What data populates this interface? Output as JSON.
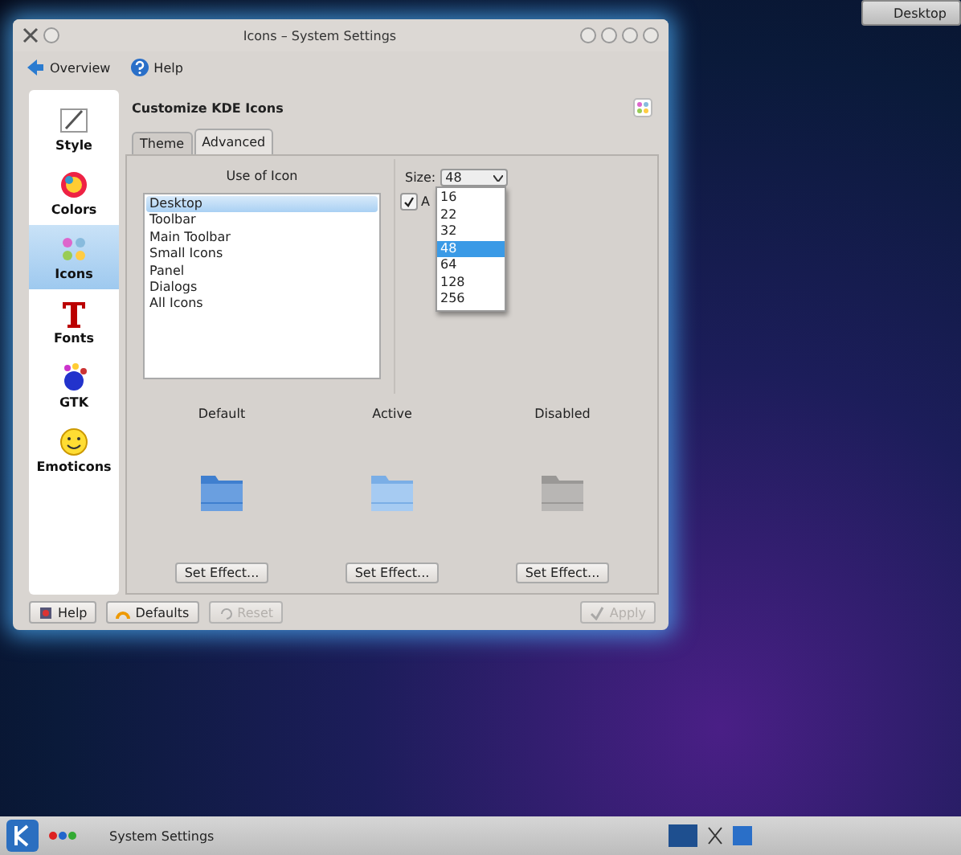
{
  "desktop_button": {
    "label": "Desktop"
  },
  "window": {
    "title": "Icons – System Settings"
  },
  "toolbar": [
    {
      "label": "Overview",
      "kind": "back"
    },
    {
      "label": "Help",
      "kind": "help"
    }
  ],
  "sidebar": {
    "items": [
      {
        "label": "Style",
        "kind": "style",
        "selected": false
      },
      {
        "label": "Colors",
        "kind": "colors",
        "selected": false
      },
      {
        "label": "Icons",
        "kind": "icons",
        "selected": true
      },
      {
        "label": "Fonts",
        "kind": "fonts",
        "selected": false
      },
      {
        "label": "GTK",
        "kind": "gtk",
        "selected": false
      },
      {
        "label": "Emoticons",
        "kind": "emoticons",
        "selected": false
      }
    ]
  },
  "page": {
    "title": "Customize KDE Icons"
  },
  "tabs": [
    {
      "label": "Theme",
      "selected": false
    },
    {
      "label": "Advanced",
      "selected": true
    }
  ],
  "usage": {
    "title": "Use of Icon",
    "items": [
      {
        "label": "Desktop",
        "selected": true
      },
      {
        "label": "Toolbar",
        "selected": false
      },
      {
        "label": "Main Toolbar",
        "selected": false
      },
      {
        "label": "Small Icons",
        "selected": false
      },
      {
        "label": "Panel",
        "selected": false
      },
      {
        "label": "Dialogs",
        "selected": false
      },
      {
        "label": "All Icons",
        "selected": false
      }
    ]
  },
  "size": {
    "label": "Size:",
    "value": "48",
    "options": [
      {
        "label": "16",
        "selected": false
      },
      {
        "label": "22",
        "selected": false
      },
      {
        "label": "32",
        "selected": false
      },
      {
        "label": "48",
        "selected": true
      },
      {
        "label": "64",
        "selected": false
      },
      {
        "label": "128",
        "selected": false
      },
      {
        "label": "256",
        "selected": false
      }
    ]
  },
  "checkbox": {
    "label": "A",
    "checked": true
  },
  "states": [
    {
      "label": "Default",
      "kind": "default",
      "button": "Set Effect..."
    },
    {
      "label": "Active",
      "kind": "active",
      "button": "Set Effect..."
    },
    {
      "label": "Disabled",
      "kind": "disabled",
      "button": "Set Effect..."
    }
  ],
  "footer": [
    {
      "label": "Help",
      "kind": "help",
      "disabled": false
    },
    {
      "label": "Defaults",
      "kind": "defaults",
      "disabled": false
    },
    {
      "label": "Reset",
      "kind": "reset",
      "disabled": true
    },
    {
      "label": "Apply",
      "kind": "apply",
      "disabled": true
    }
  ],
  "taskbar": {
    "task": "System Settings"
  }
}
